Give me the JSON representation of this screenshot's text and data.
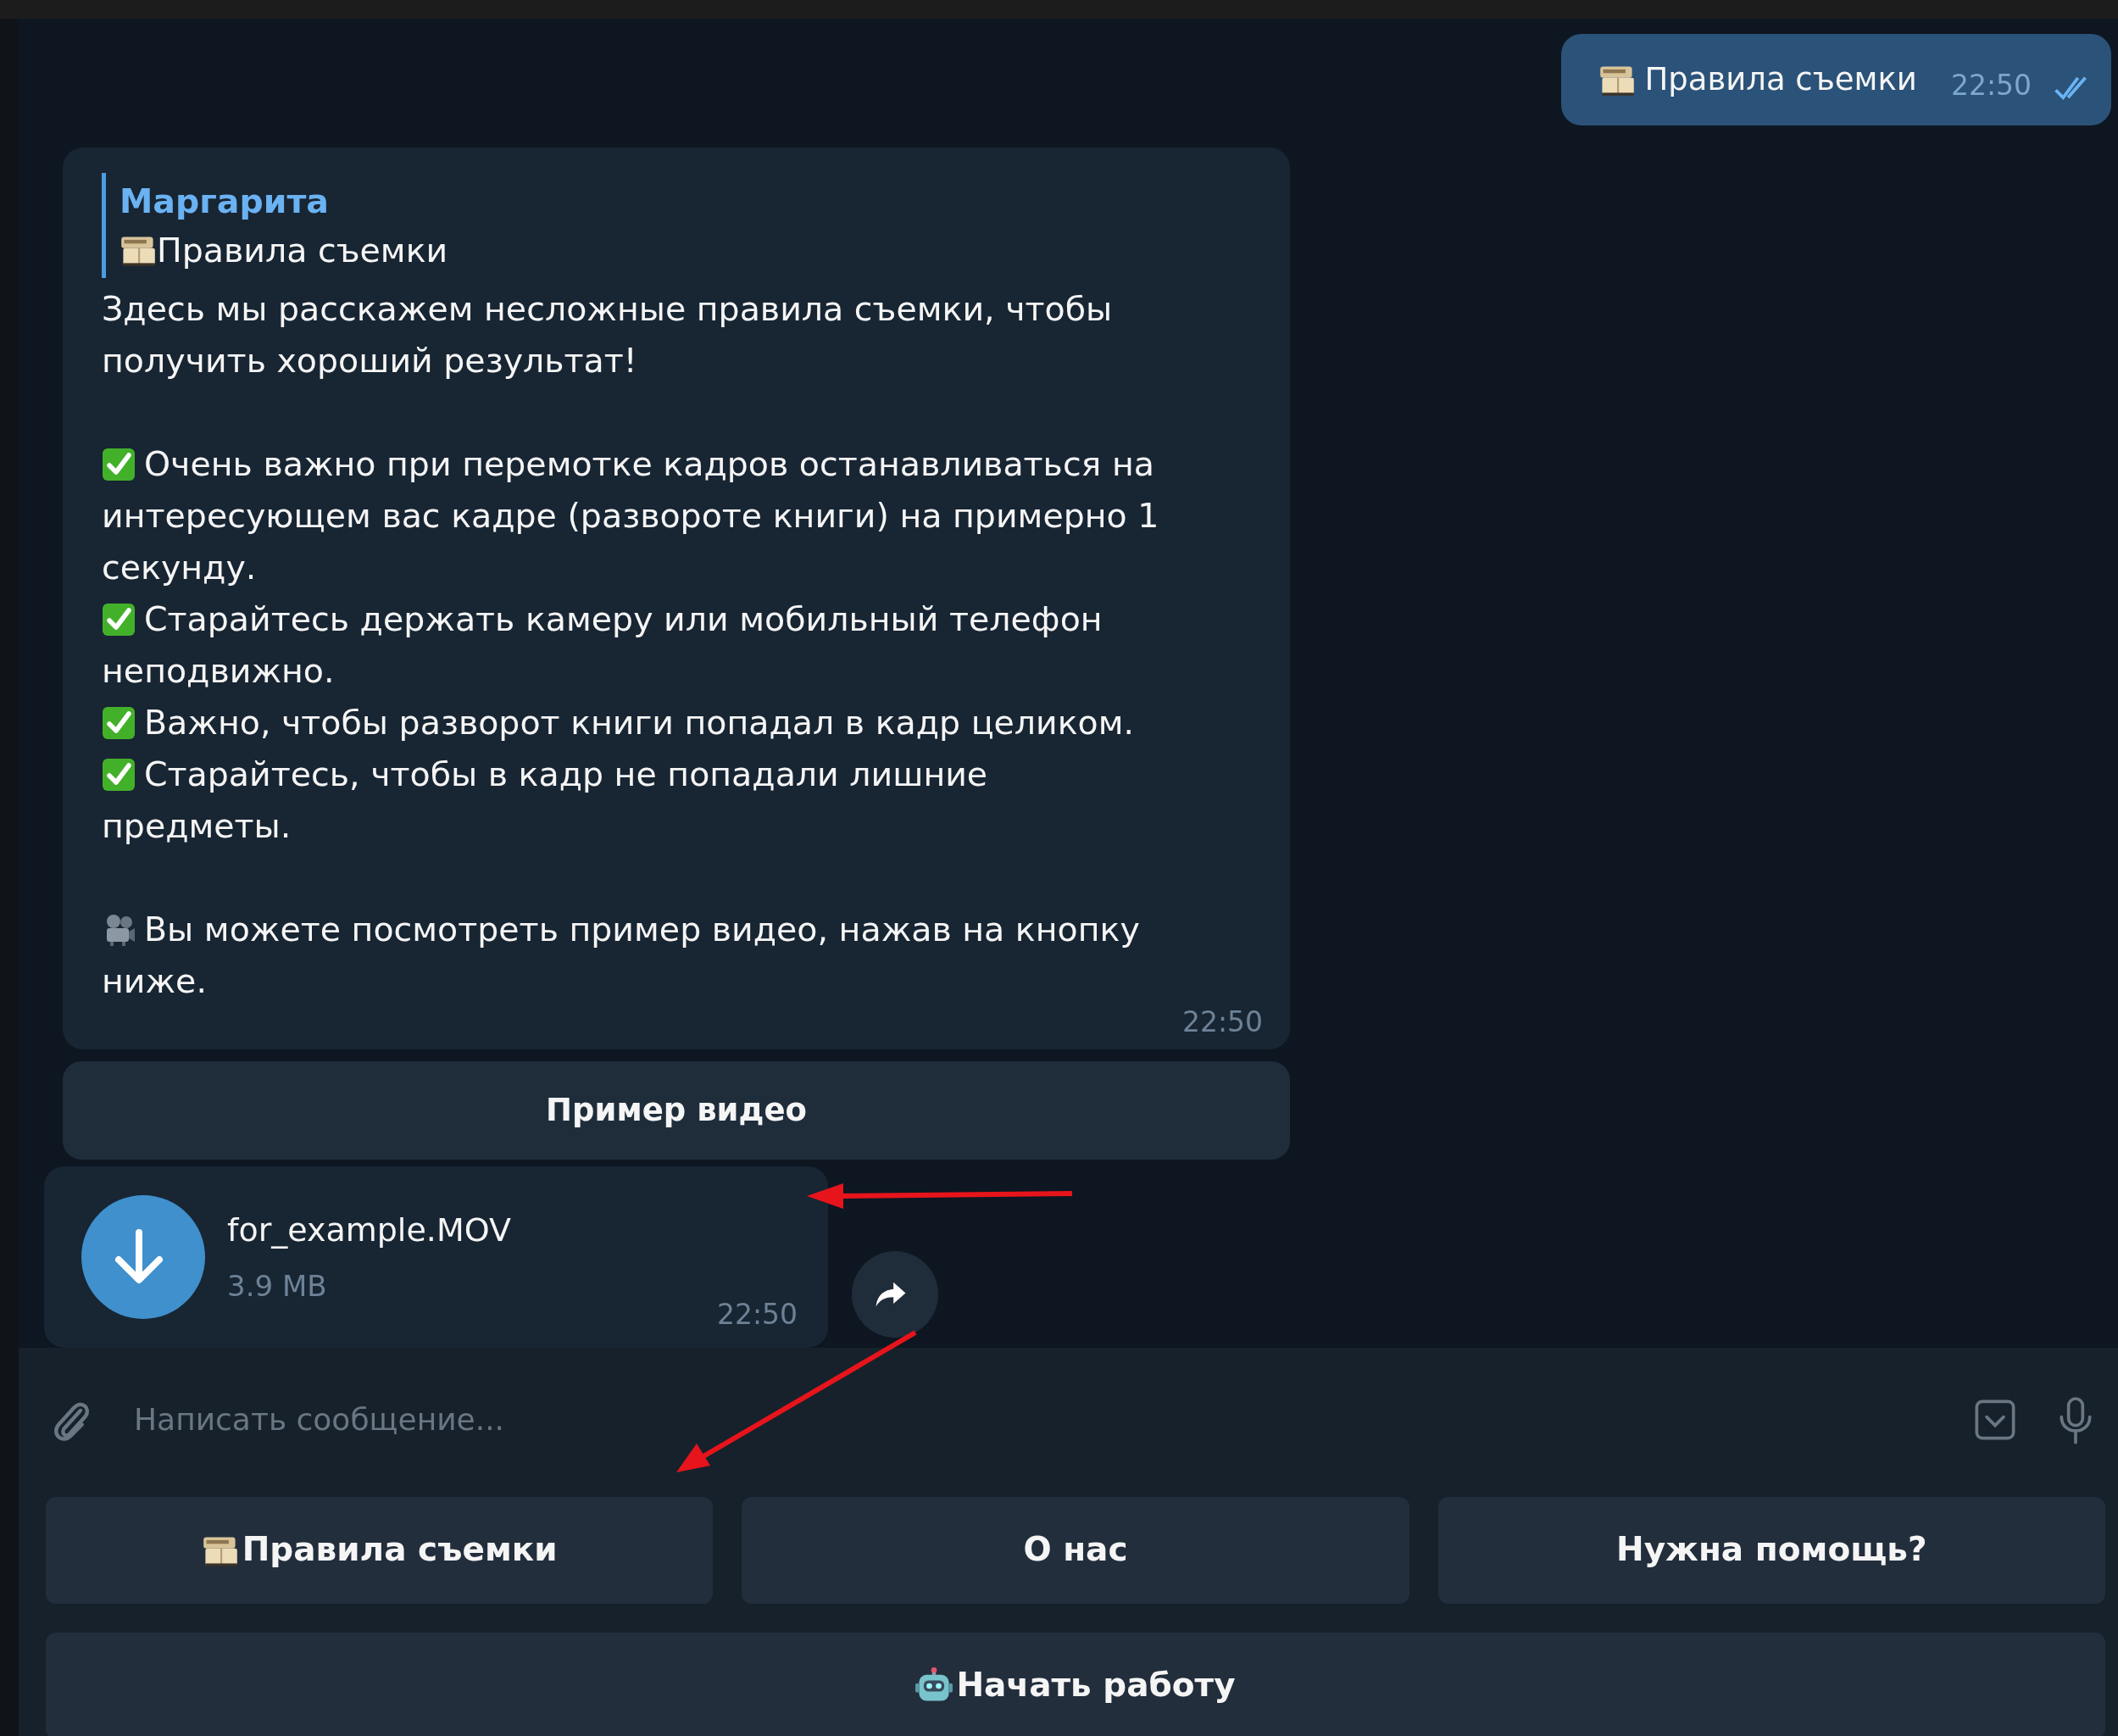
{
  "messages": [
    {
      "kind": "outgoing",
      "text": "Правила съемки",
      "time": "22:50",
      "read": true
    },
    {
      "kind": "incoming",
      "reply": {
        "author": "Маргарита",
        "text": "Правила съемки"
      },
      "blocks": [
        [
          {
            "kind": "plain",
            "text": "Здесь мы расскажем несложные правила съемки, чтобы получить хороший результат!"
          }
        ],
        [
          {
            "kind": "check",
            "text": "Очень важно при перемотке кадров останавливаться на интересующем вас кадре (развороте книги) на примерно 1 секунду."
          },
          {
            "kind": "check",
            "text": "Старайтесь держать камеру или мобильный телефон неподвижно."
          },
          {
            "kind": "check",
            "text": "Важно, чтобы разворот книги попадал в кадр целиком."
          },
          {
            "kind": "check",
            "text": "Старайтесь, чтобы в кадр не попадали лишние предметы."
          }
        ],
        [
          {
            "kind": "video",
            "text": "Вы можете посмотреть пример видео, нажав на кнопку ниже."
          }
        ]
      ],
      "time": "22:50",
      "inline_buttons": [
        "Пример видео"
      ]
    },
    {
      "kind": "file",
      "file_name": "for_example.MOV",
      "size": "3.9 MB",
      "time": "22:50"
    }
  ],
  "composer": {
    "placeholder": "Написать сообщение..."
  },
  "keyboard": [
    [
      {
        "kind": "boxed",
        "label": "Правила съемки"
      },
      {
        "kind": "plain",
        "label": "О нас"
      },
      {
        "kind": "plain",
        "label": "Нужна помощь?"
      }
    ],
    [
      {
        "kind": "robot",
        "label": "Начать работу"
      }
    ]
  ]
}
